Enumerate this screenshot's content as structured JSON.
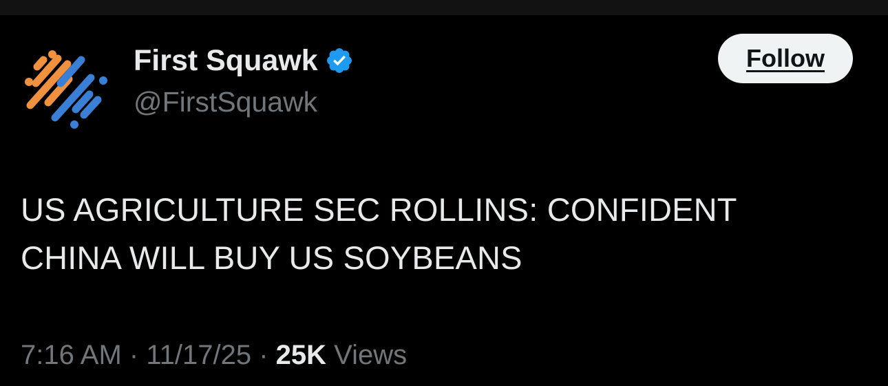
{
  "profile": {
    "display_name": "First Squawk",
    "handle": "@FirstSquawk",
    "verified_icon": "verified-badge-icon",
    "avatar_icon": "first-squawk-logo"
  },
  "actions": {
    "follow_label": "Follow"
  },
  "tweet": {
    "text": "US AGRICULTURE SEC ROLLINS: CONFIDENT\nCHINA WILL BUY US SOYBEANS"
  },
  "meta": {
    "time": "7:16 AM",
    "separator": "·",
    "date": "11/17/25",
    "views_count": "25K",
    "views_label": "Views"
  },
  "colors": {
    "background": "#000000",
    "primary_text": "#e7e9ea",
    "secondary_text": "#71767b",
    "verified_blue": "#1d9bf0",
    "follow_button_bg": "#eff3f4",
    "logo_orange": "#f0913f",
    "logo_blue": "#3a7fd6"
  }
}
